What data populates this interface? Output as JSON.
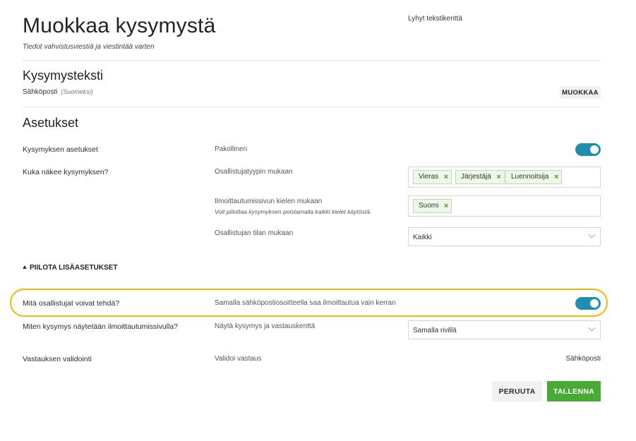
{
  "header": {
    "title": "Muokkaa kysymystä",
    "subtitle": "Tiedot vahvistusviestiä ja viestintää varten",
    "field_type": "Lyhyt tekstikenttä"
  },
  "question_text": {
    "section_title": "Kysymysteksti",
    "value": "Sähköposti",
    "language": "(Suomeksi)",
    "edit_label": "MUOKKAA"
  },
  "settings": {
    "section_title": "Asetukset",
    "question_settings": {
      "label": "Kysymyksen asetukset",
      "sub": "Pakollinen",
      "toggle_on": true
    },
    "visibility": {
      "label": "Kuka näkee kysymyksen?",
      "by_type": {
        "label": "Osallistujatyypin mukaan",
        "tags": [
          "Vieras",
          "Järjestäjä",
          "Luennoitsija"
        ]
      },
      "by_language": {
        "label": "Ilmoittautumissivun kielen mukaan",
        "hint": "Voit piilottaa kysymyksen poistamalla kaikki kielet käytöstä.",
        "tags": [
          "Suomi"
        ]
      },
      "by_status": {
        "label": "Osallistujan tilan mukaan",
        "selected": "Kaikki"
      }
    },
    "advanced_toggle": "PIILOTA LISÄASETUKSET",
    "what_can_do": {
      "label": "Mitä osallistujat voivat tehdä?",
      "sub": "Samalla sähköpostiosoitteella saa ilmoittautua vain kerran",
      "toggle_on": true
    },
    "display": {
      "label": "Miten kysymys näytetään ilmoittautumissivulla?",
      "sub": "Näytä kysymys ja vastauskenttä",
      "selected": "Samalla rivillä"
    },
    "validation": {
      "label": "Vastauksen validointi",
      "sub": "Validoi vastaus",
      "value": "Sähköposti"
    }
  },
  "actions": {
    "cancel": "PERUUTA",
    "save": "TALLENNA"
  },
  "colors": {
    "toggle": "#1f8fb0",
    "highlight": "#f2b705",
    "save": "#4aaa36",
    "tag_bg": "#eef7e8"
  }
}
